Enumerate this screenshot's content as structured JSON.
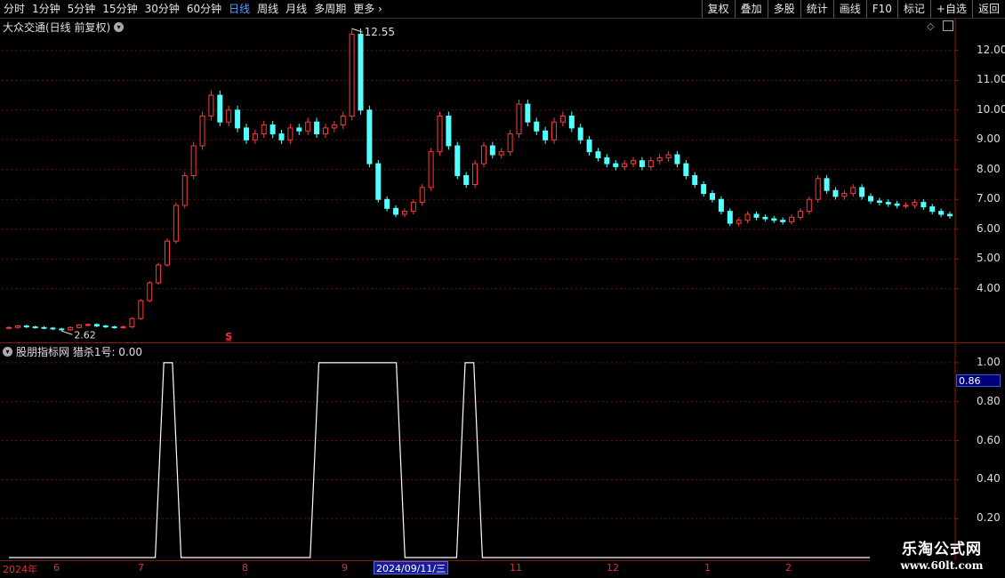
{
  "toolbar": {
    "periods": [
      "分时",
      "1分钟",
      "5分钟",
      "15分钟",
      "30分钟",
      "60分钟",
      "日线",
      "周线",
      "月线",
      "多周期"
    ],
    "active_period": "日线",
    "more_label": "更多",
    "right_buttons": [
      "复权",
      "叠加",
      "多股",
      "统计",
      "画线",
      "F10",
      "标记",
      "+自选",
      "返回"
    ]
  },
  "main_chart": {
    "title": "大众交通(日线 前复权)",
    "high_label": "12.55",
    "low_label": "2.62",
    "signal_marker": "S",
    "up_color": "#ff3b3b",
    "down_color": "#54ffff",
    "y_ticks": [
      "12.00",
      "11.00",
      "10.00",
      "9.00",
      "8.00",
      "7.00",
      "6.00",
      "5.00",
      "4.00"
    ]
  },
  "indicator": {
    "title": "股朋指标网 猎杀1号: 0.00",
    "y_ticks": [
      "1.00",
      "0.80",
      "0.60",
      "0.40",
      "0.20"
    ],
    "current_value": "0.86",
    "line_color": "#ffffff"
  },
  "date_axis": {
    "labels": [
      "2024年",
      "6",
      "7",
      "8",
      "9",
      "11",
      "12",
      "1",
      "2"
    ],
    "cursor_label": "2024/09/11/三"
  },
  "watermark": {
    "title": "乐淘公式网",
    "url": "www.60lt.com"
  },
  "chart_data": [
    {
      "type": "line",
      "title": "大众交通(日线 前复权)",
      "note_series": "approximate daily close prices, left to right",
      "ylim": [
        2.2,
        13.1
      ],
      "series": [
        {
          "values": [
            2.7,
            2.75,
            2.72,
            2.7,
            2.68,
            2.65,
            2.62,
            2.7,
            2.78,
            2.8,
            2.75,
            2.72,
            2.7,
            2.72,
            3.0,
            3.6,
            4.2,
            4.8,
            5.6,
            6.8,
            7.8,
            8.8,
            9.8,
            10.5,
            9.6,
            10.0,
            9.4,
            9.0,
            9.2,
            9.5,
            9.2,
            9.0,
            9.4,
            9.3,
            9.6,
            9.2,
            9.4,
            9.5,
            9.8,
            12.55,
            10.0,
            8.2,
            7.0,
            6.7,
            6.5,
            6.6,
            6.9,
            7.4,
            8.6,
            9.8,
            8.8,
            7.8,
            7.5,
            8.2,
            8.8,
            8.5,
            8.6,
            9.2,
            10.2,
            9.6,
            9.3,
            9.0,
            9.6,
            9.8,
            9.4,
            9.0,
            8.6,
            8.4,
            8.2,
            8.1,
            8.2,
            8.3,
            8.1,
            8.3,
            8.4,
            8.5,
            8.2,
            7.8,
            7.5,
            7.2,
            7.0,
            6.6,
            6.2,
            6.3,
            6.5,
            6.4,
            6.35,
            6.3,
            6.25,
            6.4,
            6.6,
            7.0,
            7.7,
            7.3,
            7.1,
            7.2,
            7.4,
            7.1,
            6.95,
            6.9,
            6.85,
            6.8,
            6.8,
            6.9,
            6.75,
            6.6,
            6.5,
            6.45
          ]
        }
      ]
    },
    {
      "type": "line",
      "title": "股朋指标网 猎杀1号",
      "ylim": [
        0,
        1.1
      ],
      "series": [
        {
          "values": [
            0,
            0,
            0,
            0,
            0,
            0,
            0,
            0,
            0,
            0,
            0,
            0,
            0,
            0,
            0,
            0,
            0,
            0,
            1,
            1,
            0,
            0,
            0,
            0,
            0,
            0,
            0,
            0,
            0,
            0,
            0,
            0,
            0,
            0,
            0,
            0,
            1,
            1,
            1,
            1,
            1,
            1,
            1,
            1,
            1,
            1,
            0,
            0,
            0,
            0,
            0,
            0,
            0,
            1,
            1,
            0,
            0,
            0,
            0,
            0,
            0,
            0,
            0,
            0,
            0,
            0,
            0,
            0,
            0,
            0,
            0,
            0,
            0,
            0,
            0,
            0,
            0,
            0,
            0,
            0,
            0,
            0,
            0,
            0,
            0,
            0,
            0,
            0,
            0,
            0,
            0,
            0,
            0,
            0,
            0,
            0,
            0,
            0,
            0,
            0,
            0
          ]
        }
      ]
    }
  ]
}
